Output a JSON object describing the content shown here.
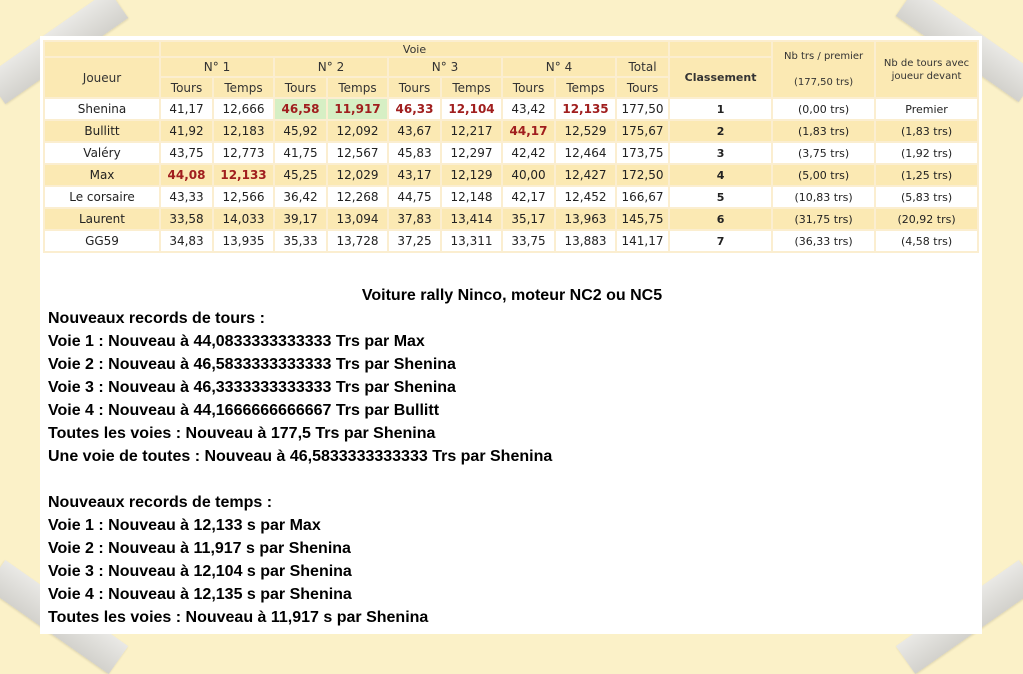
{
  "header": {
    "voie": "Voie",
    "joueur": "Joueur",
    "lanes": [
      "N° 1",
      "N° 2",
      "N° 3",
      "N° 4"
    ],
    "total": "Total",
    "tours": "Tours",
    "temps": "Temps",
    "classement": "Classement",
    "nb_trs_premier": "Nb trs / premier",
    "nb_trs_premier_value": "(177,50 trs)",
    "nb_tours_devant": "Nb de tours avec joueur devant"
  },
  "rows": [
    {
      "joueur": "Shenina",
      "n1_tours": "41,17",
      "n1_temps": "12,666",
      "n2_tours": "46,58",
      "n2_temps": "11,917",
      "n3_tours": "46,33",
      "n3_temps": "12,104",
      "n4_tours": "43,42",
      "n4_temps": "12,135",
      "total": "177,50",
      "classement": "1",
      "nb_premier": "(0,00 trs)",
      "nb_devant": "Premier"
    },
    {
      "joueur": "Bullitt",
      "n1_tours": "41,92",
      "n1_temps": "12,183",
      "n2_tours": "45,92",
      "n2_temps": "12,092",
      "n3_tours": "43,67",
      "n3_temps": "12,217",
      "n4_tours": "44,17",
      "n4_temps": "12,529",
      "total": "175,67",
      "classement": "2",
      "nb_premier": "(1,83 trs)",
      "nb_devant": "(1,83 trs)"
    },
    {
      "joueur": "Valéry",
      "n1_tours": "43,75",
      "n1_temps": "12,773",
      "n2_tours": "41,75",
      "n2_temps": "12,567",
      "n3_tours": "45,83",
      "n3_temps": "12,297",
      "n4_tours": "42,42",
      "n4_temps": "12,464",
      "total": "173,75",
      "classement": "3",
      "nb_premier": "(3,75 trs)",
      "nb_devant": "(1,92 trs)"
    },
    {
      "joueur": "Max",
      "n1_tours": "44,08",
      "n1_temps": "12,133",
      "n2_tours": "45,25",
      "n2_temps": "12,029",
      "n3_tours": "43,17",
      "n3_temps": "12,129",
      "n4_tours": "40,00",
      "n4_temps": "12,427",
      "total": "172,50",
      "classement": "4",
      "nb_premier": "(5,00 trs)",
      "nb_devant": "(1,25 trs)"
    },
    {
      "joueur": "Le corsaire",
      "n1_tours": "43,33",
      "n1_temps": "12,566",
      "n2_tours": "36,42",
      "n2_temps": "12,268",
      "n3_tours": "44,75",
      "n3_temps": "12,148",
      "n4_tours": "42,17",
      "n4_temps": "12,452",
      "total": "166,67",
      "classement": "5",
      "nb_premier": "(10,83 trs)",
      "nb_devant": "(5,83 trs)"
    },
    {
      "joueur": "Laurent",
      "n1_tours": "33,58",
      "n1_temps": "14,033",
      "n2_tours": "39,17",
      "n2_temps": "13,094",
      "n3_tours": "37,83",
      "n3_temps": "13,414",
      "n4_tours": "35,17",
      "n4_temps": "13,963",
      "total": "145,75",
      "classement": "6",
      "nb_premier": "(31,75 trs)",
      "nb_devant": "(20,92 trs)"
    },
    {
      "joueur": "GG59",
      "n1_tours": "34,83",
      "n1_temps": "13,935",
      "n2_tours": "35,33",
      "n2_temps": "13,728",
      "n3_tours": "37,25",
      "n3_temps": "13,311",
      "n4_tours": "33,75",
      "n4_temps": "13,883",
      "total": "141,17",
      "classement": "7",
      "nb_premier": "(36,33 trs)",
      "nb_devant": "(4,58 trs)"
    }
  ],
  "records": {
    "title": "Voiture rally Ninco, moteur NC2 ou NC5",
    "tours_heading": "Nouveaux records de tours :",
    "tours_lines": [
      "Voie 1 : Nouveau à 44,0833333333333 Trs par Max",
      "Voie 2 : Nouveau à 46,5833333333333 Trs par Shenina",
      "Voie 3 : Nouveau à 46,3333333333333 Trs par Shenina",
      "Voie 4 : Nouveau à 44,1666666666667 Trs par Bullitt",
      "Toutes les voies : Nouveau à 177,5 Trs par Shenina",
      "Une voie de toutes : Nouveau à 46,5833333333333 Trs par Shenina"
    ],
    "temps_heading": "Nouveaux records de temps :",
    "temps_lines": [
      "Voie 1 : Nouveau à 12,133 s par Max",
      "Voie 2 : Nouveau à 11,917 s par Shenina",
      "Voie 3 : Nouveau à 12,104 s par Shenina",
      "Voie 4 : Nouveau à 12,135 s par Shenina",
      "Toutes les voies : Nouveau à 11,917 s par Shenina"
    ]
  },
  "colors": {
    "background": "#fbf1c8",
    "header_cell": "#fbe9b3",
    "record_text": "#a01e1e",
    "highlight_green": "#d6efc4"
  }
}
